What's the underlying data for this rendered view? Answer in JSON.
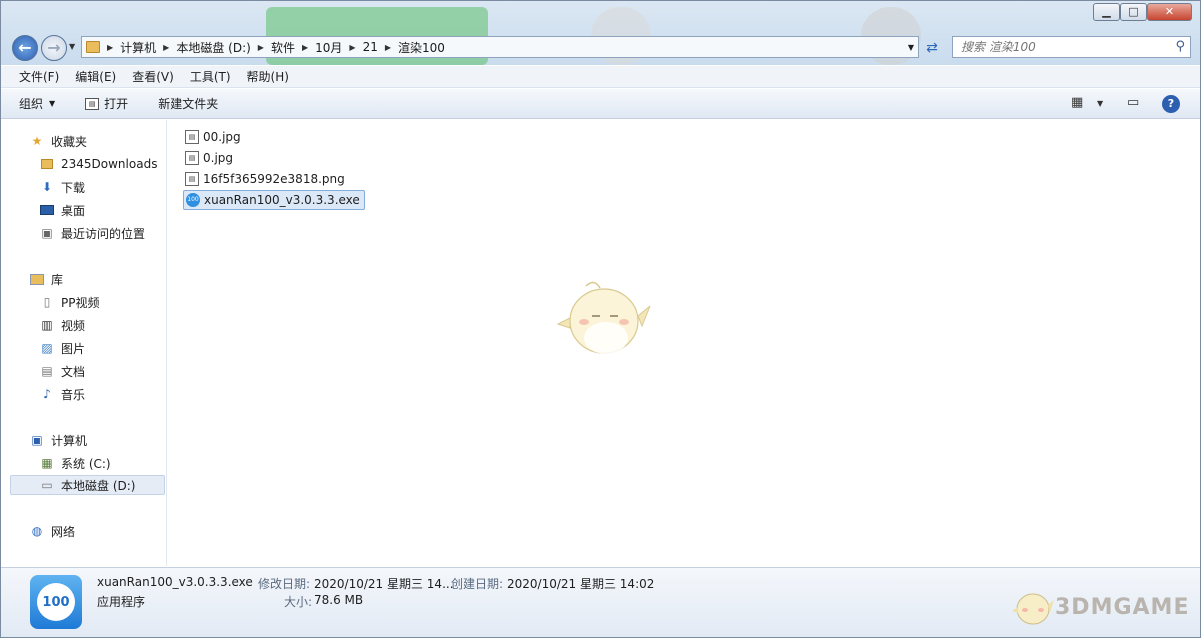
{
  "window": {
    "controls": {
      "minimize": "▁",
      "maximize": "□",
      "close": "✕"
    }
  },
  "nav": {
    "back_icon": "arrow-left-icon",
    "forward_icon": "arrow-right-icon"
  },
  "address": {
    "crumbs": [
      "计算机",
      "本地磁盘 (D:)",
      "软件",
      "10月",
      "21",
      "渲染100"
    ]
  },
  "search": {
    "placeholder": "搜索 渲染100"
  },
  "menu": [
    "文件(F)",
    "编辑(E)",
    "查看(V)",
    "工具(T)",
    "帮助(H)"
  ],
  "commands": {
    "organize": "组织",
    "open": "打开",
    "new_folder": "新建文件夹"
  },
  "sidebar": {
    "favorites": {
      "label": "收藏夹",
      "items": [
        "2345Downloads",
        "下载",
        "桌面",
        "最近访问的位置"
      ]
    },
    "libraries": {
      "label": "库",
      "items": [
        "PP视频",
        "视频",
        "图片",
        "文档",
        "音乐"
      ]
    },
    "computer": {
      "label": "计算机",
      "items": [
        "系统 (C:)",
        "本地磁盘 (D:)"
      ]
    },
    "network": {
      "label": "网络"
    }
  },
  "files": [
    "00.jpg",
    "0.jpg",
    "16f5f365992e3818.png",
    "xuanRan100_v3.0.3.3.exe"
  ],
  "details": {
    "icon_text": "100",
    "filename": "xuanRan100_v3.0.3.3.exe",
    "type": "应用程序",
    "modified_label": "修改日期:",
    "modified_value": "2020/10/21 星期三 14...",
    "created_label": "创建日期:",
    "created_value": "2020/10/21 星期三 14:02",
    "size_label": "大小:",
    "size_value": "78.6 MB"
  },
  "watermark": "3DMGAME",
  "colors": {
    "accent": "#2d5fb0",
    "selection": "#dbe8f8",
    "folder": "#e9bd5b"
  }
}
